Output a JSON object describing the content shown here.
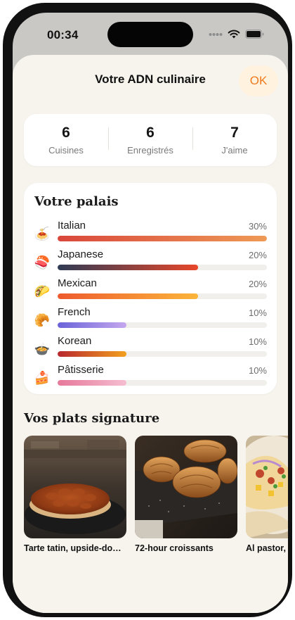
{
  "status_bar": {
    "time": "00:34"
  },
  "header": {
    "title": "Votre ADN culinaire",
    "ok_label": "OK"
  },
  "stats": [
    {
      "value": "6",
      "label": "Cuisines"
    },
    {
      "value": "6",
      "label": "Enregistrés"
    },
    {
      "value": "7",
      "label": "J'aime"
    }
  ],
  "palate": {
    "title": "Votre palais",
    "items": [
      {
        "name": "Italian",
        "percent": "30%",
        "level": 1.0,
        "icon": "spaghetti-icon",
        "emoji": "🍝",
        "colors": [
          "#d9463b",
          "#ee9a56"
        ]
      },
      {
        "name": "Japanese",
        "percent": "20%",
        "level": 0.67,
        "icon": "sushi-icon",
        "emoji": "🍣",
        "colors": [
          "#2e3b55",
          "#e8472a"
        ]
      },
      {
        "name": "Mexican",
        "percent": "20%",
        "level": 0.67,
        "icon": "taco-icon",
        "emoji": "🌮",
        "colors": [
          "#ee5a2e",
          "#fbb53a"
        ]
      },
      {
        "name": "French",
        "percent": "10%",
        "level": 0.33,
        "icon": "croissant-icon",
        "emoji": "🥐",
        "colors": [
          "#6a63d9",
          "#c4a7ee"
        ]
      },
      {
        "name": "Korean",
        "percent": "10%",
        "level": 0.33,
        "icon": "stew-bowl-icon",
        "emoji": "🍲",
        "colors": [
          "#b8272d",
          "#f2a01e"
        ]
      },
      {
        "name": "Pâtisserie",
        "percent": "10%",
        "level": 0.33,
        "icon": "cake-slice-icon",
        "emoji": "🍰",
        "colors": [
          "#e7789a",
          "#f5bdd0"
        ]
      }
    ]
  },
  "signature": {
    "title": "Vos plats signature",
    "dishes": [
      {
        "name": "Tarte tatin, upside-down apple tart"
      },
      {
        "name": "72-hour croissants"
      },
      {
        "name": "Al pastor, pineapple pork tacos"
      }
    ]
  },
  "colors": {
    "accent": "#f07a1e",
    "accent_bg": "#fff2df",
    "sheet_bg": "#f7f4ee"
  }
}
